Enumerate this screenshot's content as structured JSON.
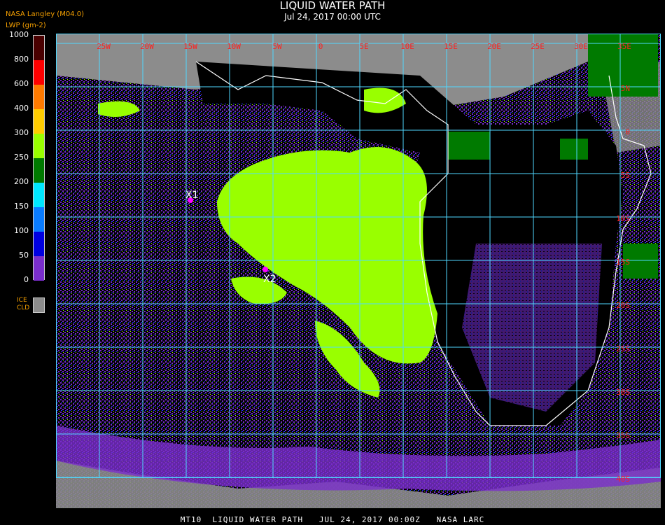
{
  "title": "LIQUID WATER PATH",
  "subtitle": "Jul 24, 2017 00:00 UTC",
  "producer": "NASA Langley (M04.0)",
  "units_label": "LWP (gm-2)",
  "colorbar": {
    "ticks": [
      "1000",
      "800",
      "600",
      "400",
      "300",
      "250",
      "200",
      "150",
      "100",
      "50",
      "0"
    ],
    "colors": [
      "#4a0000",
      "#ff0000",
      "#ff7a00",
      "#ffcc00",
      "#99ff00",
      "#007a00",
      "#00e8ff",
      "#0a7cff",
      "#0000e0",
      "#7a2ecc"
    ]
  },
  "ice_label_line1": "ICE",
  "ice_label_line2": "CLD",
  "map": {
    "lon_labels": [
      "25W",
      "20W",
      "15W",
      "10W",
      "5W",
      "0",
      "5E",
      "10E",
      "15E",
      "20E",
      "25E",
      "30E",
      "35E"
    ],
    "lat_labels": [
      "5N",
      "0",
      "5S",
      "10S",
      "15S",
      "20S",
      "25S",
      "30S",
      "35S",
      "40S"
    ],
    "markers": [
      {
        "label": "X1",
        "color": "#ff00ff"
      },
      {
        "label": "X2",
        "color": "#ff00ff"
      }
    ]
  },
  "footer": "MT10  LIQUID WATER PATH   JUL 24, 2017 00:00Z   NASA LARC",
  "colors": {
    "grid": "#4fd8ff",
    "label": "#ff2020",
    "coast": "#ffffff",
    "ice": "#8c8c8c",
    "lwp_low": "#7a2ecc",
    "lwp_mid": "#99ff00",
    "lwp_green": "#007a00",
    "lwp_blue": "#2038ff"
  }
}
